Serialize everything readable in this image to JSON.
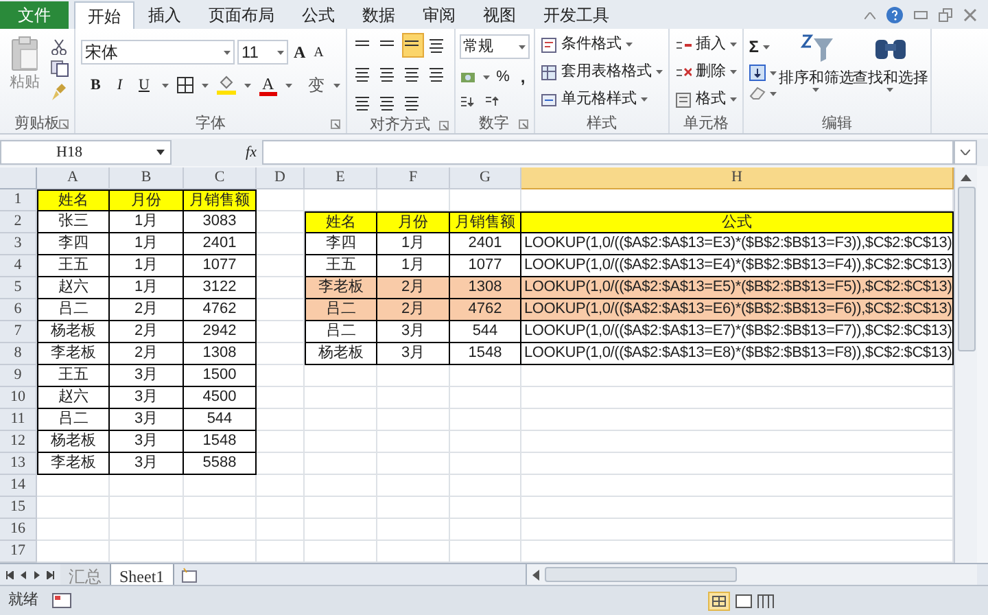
{
  "tabs": [
    {
      "label": "文件",
      "kind": "file",
      "selected": false
    },
    {
      "label": "开始",
      "kind": "tab",
      "selected": true
    },
    {
      "label": "插入",
      "kind": "tab",
      "selected": false
    },
    {
      "label": "页面布局",
      "kind": "tab",
      "selected": false
    },
    {
      "label": "公式",
      "kind": "tab",
      "selected": false
    },
    {
      "label": "数据",
      "kind": "tab",
      "selected": false
    },
    {
      "label": "审阅",
      "kind": "tab",
      "selected": false
    },
    {
      "label": "视图",
      "kind": "tab",
      "selected": false
    },
    {
      "label": "开发工具",
      "kind": "tab",
      "selected": false
    }
  ],
  "ribbon": {
    "clipboard": {
      "label": "剪贴板",
      "paste": "粘贴"
    },
    "font": {
      "label": "字体",
      "font_name": "宋体",
      "font_size": "11",
      "grow": "A",
      "shrink": "A",
      "bold": "B",
      "italic": "I",
      "underline": "U",
      "font_color": "A",
      "phonetic": "变"
    },
    "alignment": {
      "label": "对齐方式",
      "vertical_buttons": [
        {
          "selected": false
        },
        {
          "selected": false
        },
        {
          "selected": true
        }
      ]
    },
    "number": {
      "label": "数字",
      "format": "常规",
      "percent": "%",
      "comma": ","
    },
    "styles": {
      "label": "样式",
      "items": [
        "条件格式",
        "套用表格格式",
        "单元格样式"
      ]
    },
    "cells": {
      "label": "单元格",
      "items": [
        "插入",
        "删除",
        "格式"
      ]
    },
    "editing": {
      "label": "编辑",
      "sum": "Σ",
      "items": [
        "排序和筛选",
        "查找和选择"
      ]
    }
  },
  "formula_bar": {
    "name_box": "H18",
    "fx_label": "fx"
  },
  "columns": [
    {
      "label": "A",
      "selected": false
    },
    {
      "label": "B",
      "selected": false
    },
    {
      "label": "C",
      "selected": false
    },
    {
      "label": "D",
      "selected": false
    },
    {
      "label": "E",
      "selected": false
    },
    {
      "label": "F",
      "selected": false
    },
    {
      "label": "G",
      "selected": false
    },
    {
      "label": "H",
      "selected": true
    }
  ],
  "row_numbers": [
    "1",
    "2",
    "3",
    "4",
    "5",
    "6",
    "7",
    "8",
    "9",
    "10",
    "11",
    "12",
    "13",
    "14",
    "15",
    "16",
    "17"
  ],
  "left_table": {
    "header": [
      "姓名",
      "月份",
      "月销售额"
    ],
    "rows": [
      [
        "张三",
        "1月",
        "3083"
      ],
      [
        "李四",
        "1月",
        "2401"
      ],
      [
        "王五",
        "1月",
        "1077"
      ],
      [
        "赵六",
        "1月",
        "3122"
      ],
      [
        "吕二",
        "2月",
        "4762"
      ],
      [
        "杨老板",
        "2月",
        "2942"
      ],
      [
        "李老板",
        "2月",
        "1308"
      ],
      [
        "王五",
        "3月",
        "1500"
      ],
      [
        "赵六",
        "3月",
        "4500"
      ],
      [
        "吕二",
        "3月",
        "544"
      ],
      [
        "杨老板",
        "3月",
        "1548"
      ],
      [
        "李老板",
        "3月",
        "5588"
      ]
    ]
  },
  "right_table": {
    "header": [
      "姓名",
      "月份",
      "月销售额",
      "公式"
    ],
    "rows": [
      {
        "cells": [
          "李四",
          "1月",
          "2401",
          "LOOKUP(1,0/(($A$2:$A$13=E3)*($B$2:$B$13=F3)),$C$2:$C$13)"
        ],
        "highlighted": false
      },
      {
        "cells": [
          "王五",
          "1月",
          "1077",
          "LOOKUP(1,0/(($A$2:$A$13=E4)*($B$2:$B$13=F4)),$C$2:$C$13)"
        ],
        "highlighted": false
      },
      {
        "cells": [
          "李老板",
          "2月",
          "1308",
          "LOOKUP(1,0/(($A$2:$A$13=E5)*($B$2:$B$13=F5)),$C$2:$C$13)"
        ],
        "highlighted": true
      },
      {
        "cells": [
          "吕二",
          "2月",
          "4762",
          "LOOKUP(1,0/(($A$2:$A$13=E6)*($B$2:$B$13=F6)),$C$2:$C$13)"
        ],
        "highlighted": true
      },
      {
        "cells": [
          "吕二",
          "3月",
          "544",
          "LOOKUP(1,0/(($A$2:$A$13=E7)*($B$2:$B$13=F7)),$C$2:$C$13)"
        ],
        "highlighted": false
      },
      {
        "cells": [
          "杨老板",
          "3月",
          "1548",
          "LOOKUP(1,0/(($A$2:$A$13=E8)*($B$2:$B$13=F8)),$C$2:$C$13)"
        ],
        "highlighted": false
      }
    ]
  },
  "sheet_tabs": [
    {
      "label": "汇总",
      "selected": false
    },
    {
      "label": "Sheet1",
      "selected": true
    }
  ],
  "status_bar": {
    "text": "就绪"
  }
}
